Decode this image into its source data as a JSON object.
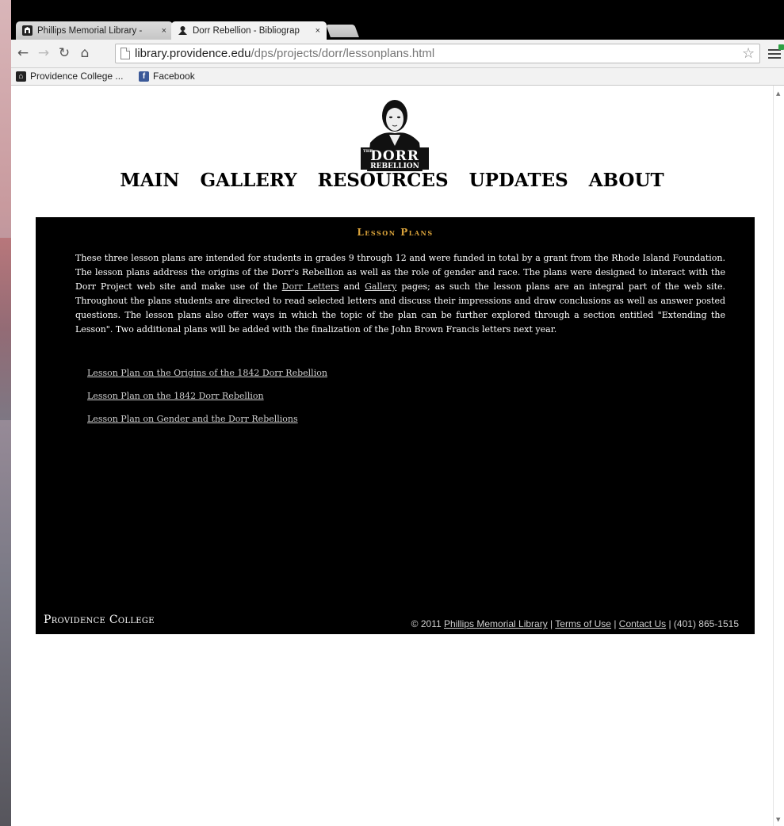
{
  "browser": {
    "tabs": [
      {
        "title": "Phillips Memorial Library -",
        "close": "×"
      },
      {
        "title": "Dorr Rebellion - Bibliograp",
        "close": "×"
      }
    ],
    "url_host": "library.providence.edu",
    "url_path": "/dps/projects/dorr/lessonplans.html",
    "bookmarks": [
      {
        "label": "Providence College ...",
        "icon": "college-seal-icon"
      },
      {
        "label": "Facebook",
        "icon": "facebook-icon"
      }
    ]
  },
  "site": {
    "logo": {
      "small": "THE",
      "line1": "DORR",
      "line2": "REBELLION"
    },
    "nav": [
      "MAIN",
      "GALLERY",
      "RESOURCES",
      "UPDATES",
      "ABOUT"
    ]
  },
  "content": {
    "title": "Lesson Plans",
    "intro_part1": "These three lesson plans are intended for students in grades 9 through 12 and were funded in total by a grant from the Rhode Island Foundation. The lesson plans address the origins of the Dorr's Rebellion as well as the role of gender and race. The plans were designed to interact with the Dorr Project web site and make use of the ",
    "intro_link1": "Dorr Letters",
    "intro_part2": " and ",
    "intro_link2": "Gallery",
    "intro_part3": " pages; as such the lesson plans are an integral part of the web site. Throughout the plans students are directed to read selected letters and discuss their impressions and draw conclusions as well as answer posted questions. The lesson plans also offer ways in which the topic of the plan can be further explored through a section entitled \"Extending the Lesson\". Two additional plans will be added with the finalization of the John Brown Francis letters next year.",
    "links": [
      "Lesson Plan on the Origins of the 1842 Dorr Rebellion",
      "Lesson Plan on the 1842 Dorr Rebellion",
      "Lesson Plan on Gender and the Dorr Rebellions"
    ]
  },
  "footer": {
    "brand": "Providence College",
    "copyright": "© 2011 ",
    "link_library": "Phillips Memorial Library",
    "sep1": " | ",
    "link_terms": "Terms of Use",
    "sep2": " | ",
    "link_contact": "Contact Us",
    "phone": " | (401) 865-1515"
  },
  "colors": {
    "panel_bg": "#000000",
    "title_gold": "#d7a13a"
  }
}
